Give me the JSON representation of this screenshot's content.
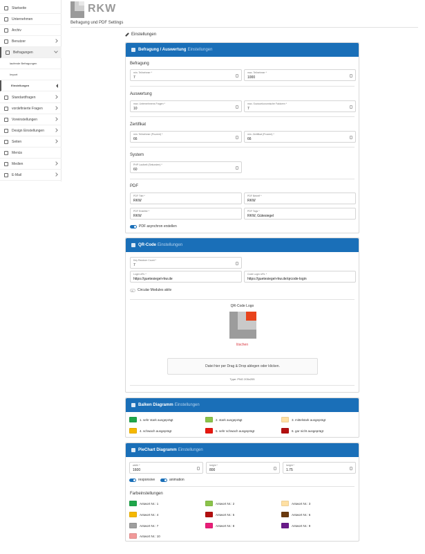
{
  "sidebar": {
    "items": [
      {
        "label": "Startseite"
      },
      {
        "label": "Unternehmen"
      },
      {
        "label": "Archiv"
      },
      {
        "label": "Benutzer"
      },
      {
        "label": "Befragungen"
      },
      {
        "label": "laufende Befragungen"
      },
      {
        "label": "Import"
      },
      {
        "label": "Einstellungen"
      },
      {
        "label": "Standardfragen"
      },
      {
        "label": "vordefinierte Fragen"
      },
      {
        "label": "Voreinstellungen"
      },
      {
        "label": "Design Einstellungen"
      },
      {
        "label": "Seiten"
      },
      {
        "label": "Menüs"
      },
      {
        "label": "Medien"
      },
      {
        "label": "E-Mail"
      }
    ]
  },
  "header": {
    "brand": "RKW",
    "subtitle": "Befragung und PDF Settings",
    "breadcrumb": "Einstellungen"
  },
  "befragung_card": {
    "title_strong": "Befragung / Auswertung",
    "title_light": "Einstellungen",
    "sections": {
      "befragung": "Befragung",
      "auswertung": "Auswertung",
      "zertifikat": "Zertifikat",
      "system": "System",
      "pdf": "PDF"
    },
    "fields": {
      "min_teilnehmer": {
        "label": "min. Teilnehmer *",
        "value": "7"
      },
      "max_teilnehmer": {
        "label": "max. Teilnehmer *",
        "value": "1000"
      },
      "max_unternehmens_fragen": {
        "label": "max. Unternehmens Fragen *",
        "value": "10"
      },
      "max_soziooekonomische": {
        "label": "max. Soziooekonomische Faktoren *",
        "value": "7"
      },
      "min_teilnehmer_prozent": {
        "label": "min. Teilnehmer (Prozent) *",
        "value": "66"
      },
      "min_zertifikat_prozent": {
        "label": "min. Zertifikat (Prozent) *",
        "value": "66"
      },
      "php_laufzeit": {
        "label": "PHP Laufzeit (Sekunden) *",
        "value": "60"
      },
      "pdf_titel": {
        "label": "PDF Titel *",
        "value": "RKW"
      },
      "pdf_betreff": {
        "label": "PDF Betreff *",
        "value": "RKW"
      },
      "pdf_ersteller": {
        "label": "PDF Ersteller *",
        "value": "RKW"
      },
      "pdf_tags": {
        "label": "PDF Tags *",
        "value": "RKW, Gütesiegel"
      }
    },
    "pdf_async_label": "PDF asynchron erstellen"
  },
  "qr_card": {
    "title_strong": "QR-Code",
    "title_light": "Einstellungen",
    "fields": {
      "key_random_count": {
        "label": "Key Random Count *",
        "value": "7"
      },
      "login_url": {
        "label": "Login URL *",
        "value": "https://guetesiegel-rkw.de"
      },
      "code_login_url": {
        "label": "Code Login URL *",
        "value": "https://guetesiegel-rkw.de/qrcode-login"
      }
    },
    "circular_label": "Circular Modules aktiv",
    "logo_label": "QR-Code Logo",
    "delete_label": "löschen",
    "drop_text": "Datei hier per Drag & Drop ablegen oder klicken.",
    "type_hint": "Type: PNG 205x205"
  },
  "balken_card": {
    "title_strong": "Balken Diagramm",
    "title_light": "Einstellungen",
    "items": [
      {
        "label": "1. sehr stark ausgeprägt",
        "color": "#1fa64a"
      },
      {
        "label": "2. stark ausgeprägt",
        "color": "#8bc34a"
      },
      {
        "label": "3. mittelstark ausgeprägt",
        "color": "#ffe0a3"
      },
      {
        "label": "4. schwach ausgeprägt",
        "color": "#f5b800"
      },
      {
        "label": "5. sehr schwach ausgeprägt",
        "color": "#e8170f"
      },
      {
        "label": "6. gar nicht ausgeprägt",
        "color": "#b30f0f"
      }
    ]
  },
  "pie_card": {
    "title_strong": "PieChart Diagramm",
    "title_light": "Einstellungen",
    "fields": {
      "width": {
        "label": "width *",
        "value": "1600"
      },
      "height1": {
        "label": "height *",
        "value": "800"
      },
      "height2": {
        "label": "height *",
        "value": "1.75"
      }
    },
    "responsive_label": "responsive",
    "animation_label": "animation",
    "farb_title": "Farbeinstellungen",
    "items": [
      {
        "label": "Antwort Nr.: 1",
        "color": "#1fa64a"
      },
      {
        "label": "Antwort Nr.: 2",
        "color": "#8bc34a"
      },
      {
        "label": "Antwort Nr.: 3",
        "color": "#ffe0a3"
      },
      {
        "label": "Antwort Nr.: 4",
        "color": "#f5b800"
      },
      {
        "label": "Antwort Nr.: 5",
        "color": "#b30f0f"
      },
      {
        "label": "Antwort Nr.: 6",
        "color": "#6b3a0e"
      },
      {
        "label": "Antwort Nr.: 7",
        "color": "#9e9e9e"
      },
      {
        "label": "Antwort Nr.: 8",
        "color": "#e91e78"
      },
      {
        "label": "Antwort Nr.: 9",
        "color": "#6a1b8a"
      },
      {
        "label": "Antwort Nr.: 10",
        "color": "#f19a9a"
      }
    ]
  },
  "colors": {
    "accent": "#1a6fb8",
    "delete": "#d9363e"
  }
}
